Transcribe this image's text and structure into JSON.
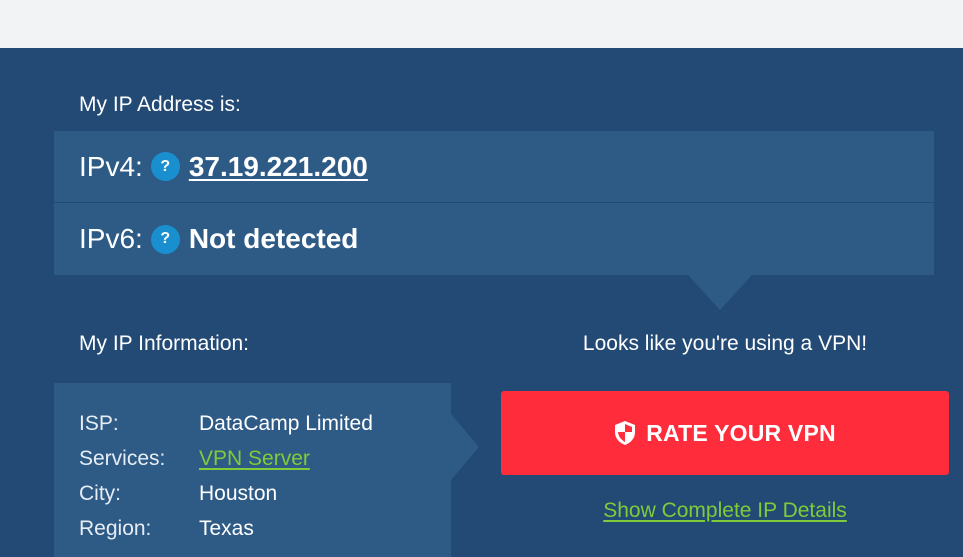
{
  "my_ip": {
    "heading": "My IP Address is:",
    "ipv4": {
      "label": "IPv4:",
      "help": "?",
      "value": "37.19.221.200"
    },
    "ipv6": {
      "label": "IPv6:",
      "help": "?",
      "value": "Not detected"
    }
  },
  "ip_info": {
    "heading": "My IP Information:",
    "rows": [
      {
        "key": "ISP:",
        "value": "DataCamp Limited"
      },
      {
        "key": "Services:",
        "value": "VPN Server"
      },
      {
        "key": "City:",
        "value": "Houston"
      },
      {
        "key": "Region:",
        "value": "Texas"
      }
    ]
  },
  "vpn": {
    "message": "Looks like you're using a VPN!",
    "rate_button_label": "RATE YOUR VPN",
    "rate_button_icon": "shield-icon",
    "details_link": "Show Complete IP Details"
  },
  "colors": {
    "panel_bg": "#224a75",
    "row_bg": "#2e5a86",
    "help_badge": "#1a8fd0",
    "accent_red": "#ff2d3c",
    "link_green": "#7fcb3a"
  }
}
